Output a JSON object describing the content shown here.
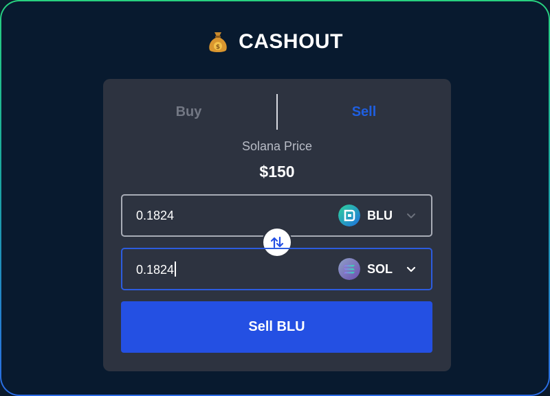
{
  "header": {
    "icon": "money-bag-icon",
    "title": "CASHOUT"
  },
  "tabs": {
    "buy_label": "Buy",
    "sell_label": "Sell",
    "active": "Sell"
  },
  "price": {
    "label": "Solana Price",
    "value": "$150"
  },
  "from_field": {
    "amount": "0.1824",
    "token": "BLU",
    "token_icon": "blu-token-icon"
  },
  "to_field": {
    "amount": "0.1824",
    "token": "SOL",
    "token_icon": "solana-token-icon"
  },
  "swap": {
    "icon": "swap-arrows-icon"
  },
  "action": {
    "label": "Sell BLU"
  },
  "colors": {
    "background": "#081a2f",
    "card": "#2d3340",
    "accent": "#2450e3",
    "active_tab": "#1f5fe0",
    "inactive_tab": "#737884"
  }
}
